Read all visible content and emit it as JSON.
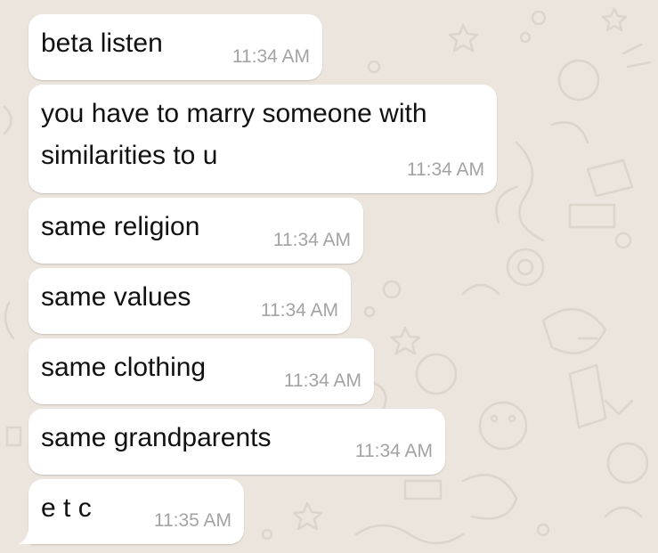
{
  "messages": [
    {
      "text": "beta listen",
      "time": "11:34 AM"
    },
    {
      "text": "you have to marry someone with\nsimilarities to u",
      "time": "11:34 AM"
    },
    {
      "text": "same religion",
      "time": "11:34 AM"
    },
    {
      "text": "same values",
      "time": "11:34 AM"
    },
    {
      "text": "same clothing",
      "time": "11:34 AM"
    },
    {
      "text": "same grandparents",
      "time": "11:34 AM"
    },
    {
      "text": "e t c",
      "time": "11:35 AM"
    }
  ],
  "colors": {
    "background": "#ece5dd",
    "bubble": "#ffffff",
    "timestamp": "#a3a3a3",
    "text": "#111111"
  }
}
